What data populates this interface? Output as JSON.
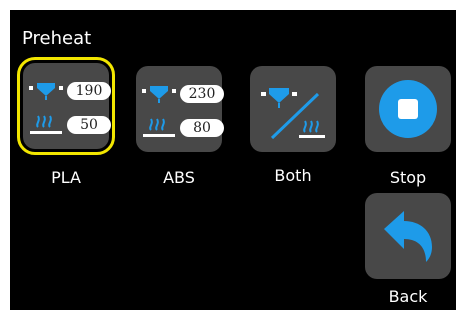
{
  "screen": {
    "title": "Preheat"
  },
  "presets": [
    {
      "label": "PLA",
      "nozzle_temp": "190",
      "bed_temp": "50",
      "selected": true
    },
    {
      "label": "ABS",
      "nozzle_temp": "230",
      "bed_temp": "80",
      "selected": false
    }
  ],
  "actions": {
    "both_label": "Both",
    "stop_label": "Stop",
    "back_label": "Back"
  },
  "colors": {
    "accent": "#1e9be9",
    "tile": "#484848",
    "selection": "#f2e600",
    "background": "#000000"
  },
  "icons": {
    "nozzle": "nozzle-icon",
    "heatbed": "heatbed-icon",
    "stop": "stop-icon",
    "back": "back-arrow-icon"
  }
}
